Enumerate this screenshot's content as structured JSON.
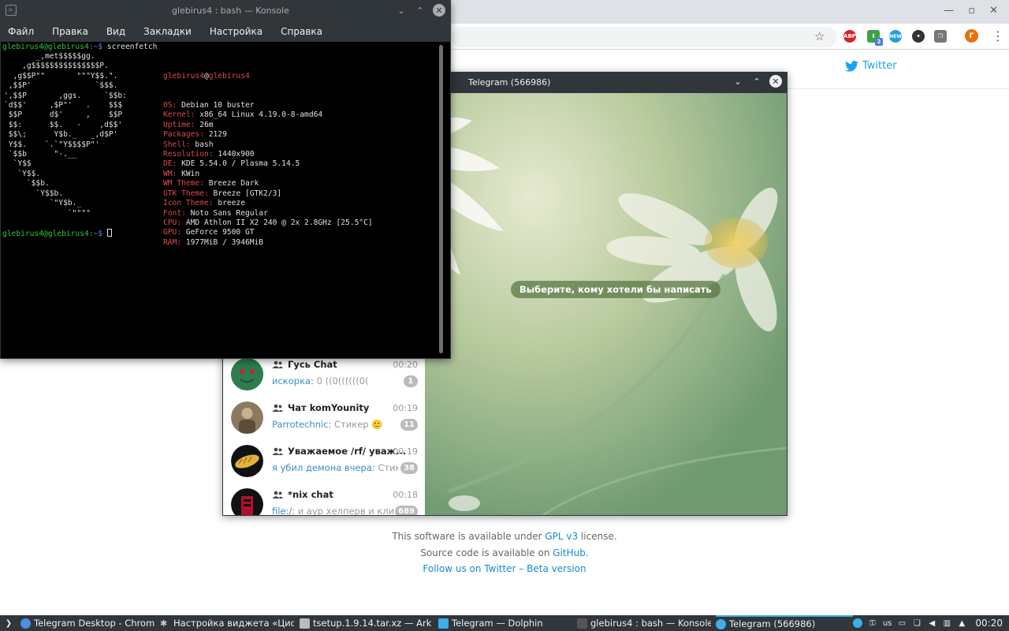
{
  "browser": {
    "page_link_twitter": "Twitter",
    "footer": {
      "line1_prefix": "This software is available under ",
      "line1_link": "GPL v3",
      "line1_suffix": " license.",
      "line2_prefix": "Source code is available on ",
      "line2_link": "GitHub",
      "line2_suffix": ".",
      "line3_link1": "Follow us on Twitter",
      "line3_sep": " – ",
      "line3_link2": "Beta version"
    },
    "extensions": {
      "abp": "ABP",
      "green_badge": "2",
      "blue": "NEW",
      "user": "Г"
    }
  },
  "konsole": {
    "title": "glebirus4 : bash — Konsole",
    "menu": [
      "Файл",
      "Правка",
      "Вид",
      "Закладки",
      "Настройка",
      "Справка"
    ],
    "prompt_user": "glebirus4@glebirus4",
    "prompt_path": ":~$",
    "command": " screenfetch",
    "art_lines": [
      "       _,met$$$$$gg.",
      "    ,g$$$$$$$$$$$$$$$P.",
      "  ,g$$P\"\"       \"\"\"Y$$.\".",
      " ,$$P'              `$$$.",
      "',$$P       ,ggs.     `$$b:",
      "`d$$'     ,$P\"'   .    $$$",
      " $$P      d$'     ,    $$P",
      " $$:      $$.   -    ,d$$'",
      " $$\\;      Y$b._   _,d$P'",
      " Y$$.    `.`\"Y$$$$P\"'",
      " `$$b      \"-.__",
      "  `Y$$",
      "   `Y$$.",
      "     `$$b.",
      "       `Y$$b.",
      "          `\"Y$b._",
      "              `\"\"\"\""
    ],
    "info_host_user": "glebirus4",
    "info_host_at": "@",
    "info_host_name": "glebirus4",
    "info": [
      {
        "key": "OS:",
        "val": " Debian 10 buster"
      },
      {
        "key": "Kernel:",
        "val": " x86_64 Linux 4.19.0-8-amd64"
      },
      {
        "key": "Uptime:",
        "val": " 26m"
      },
      {
        "key": "Packages:",
        "val": " 2129"
      },
      {
        "key": "Shell:",
        "val": " bash"
      },
      {
        "key": "Resolution:",
        "val": " 1440x900"
      },
      {
        "key": "DE:",
        "val": " KDE 5.54.0 / Plasma 5.14.5"
      },
      {
        "key": "WM:",
        "val": " KWin"
      },
      {
        "key": "WM Theme:",
        "val": " Breeze Dark"
      },
      {
        "key": "GTK Theme:",
        "val": " Breeze [GTK2/3]"
      },
      {
        "key": "Icon Theme:",
        "val": " breeze"
      },
      {
        "key": "Font:",
        "val": " Noto Sans Regular"
      },
      {
        "key": "CPU:",
        "val": " AMD Athlon II X2 240 @ 2x 2.8GHz [25.5°C]"
      },
      {
        "key": "GPU:",
        "val": " GeForce 9500 GT"
      },
      {
        "key": "RAM:",
        "val": " 1977MiB / 3946MiB"
      }
    ]
  },
  "telegram": {
    "title": "Telegram (566986)",
    "empty_message": "Выберите, кому хотели бы написать",
    "chats": [
      {
        "name": "Гусь Chat",
        "time": "00:20",
        "sender": "искорка:",
        "preview": " 0 ((0((((((0(",
        "badge": "1",
        "avatar_color": "#2e7d4f"
      },
      {
        "name": "Чат komYounity",
        "time": "00:19",
        "sender": "Parrotechnic:",
        "preview": " Стикер 🙂",
        "badge": "11",
        "avatar_color": "#8a7a60"
      },
      {
        "name": "Уважаемое /rf/ уваж...",
        "time": "00:19",
        "sender": "я убил демона вчера:",
        "preview": " Стик...",
        "badge": "38",
        "avatar_color": "#111111"
      },
      {
        "name": "*nix chat",
        "time": "00:18",
        "sender": "file:/:",
        "preview": " и аур хелперв и кли...",
        "badge": "689",
        "avatar_color": "#b0102a"
      }
    ]
  },
  "taskbar": {
    "tasks": [
      {
        "label": "Telegram Desktop - Chromiu...",
        "color": "#4a8fe0"
      },
      {
        "label": "Настройка виджета «Цифр...",
        "color": "#cccccc"
      },
      {
        "label": "tsetup.1.9.14.tar.xz — Ark",
        "color": "#bbbbbb"
      },
      {
        "label": "Telegram — Dolphin",
        "color": "#3daee9"
      },
      {
        "label": "glebirus4 : bash — Konsole",
        "color": "#555555"
      },
      {
        "label": "Telegram (566986)",
        "color": "#3daee9"
      }
    ],
    "keyboard_layout": "us",
    "clock": "00:20"
  }
}
